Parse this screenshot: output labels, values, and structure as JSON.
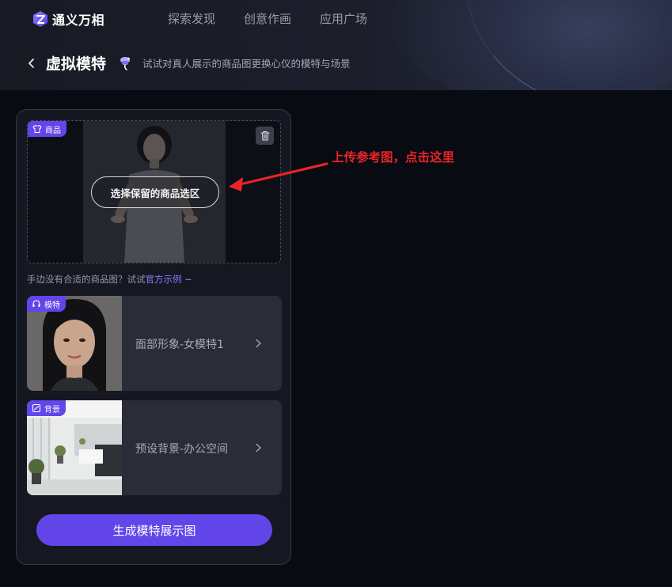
{
  "header": {
    "logo_text": "通义万相",
    "nav": [
      "探索发现",
      "创意作画",
      "应用广场"
    ],
    "page_title": "虚拟模特",
    "subtitle": "试试对真人展示的商品图更换心仪的模特与场景"
  },
  "upload": {
    "tag_label": "商品",
    "select_button": "选择保留的商品选区",
    "icons": {
      "tag": "shirt-icon",
      "delete": "trash-icon"
    }
  },
  "hint": {
    "text": "手边没有合适的商品图？试试",
    "link": "官方示例 ~"
  },
  "model_card": {
    "tag_label": "模特",
    "label": "面部形象-女模特1"
  },
  "background_card": {
    "tag_label": "背景",
    "label": "预设背景-办公空间"
  },
  "generate_button": "生成模特展示图",
  "annotation": "上传参考图，点击这里",
  "colors": {
    "accent": "#6246ea",
    "link": "#8a7cff",
    "annotation": "#e8242a",
    "background": "#090b12"
  }
}
